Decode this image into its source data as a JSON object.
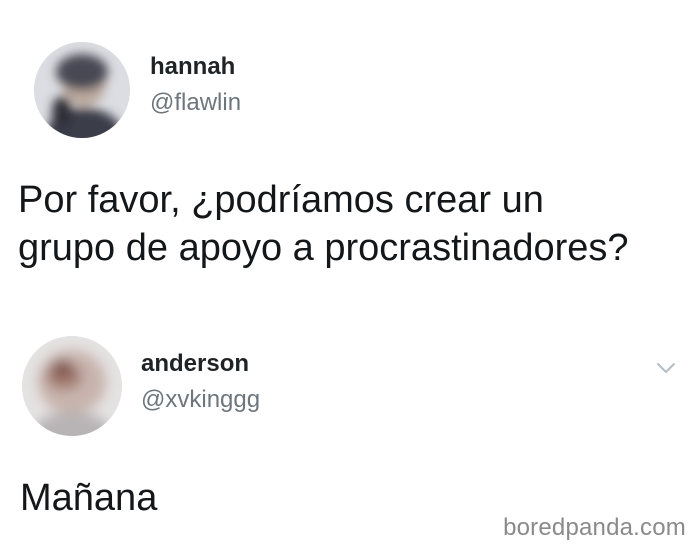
{
  "tweets": [
    {
      "display_name": "hannah",
      "handle": "@flawlin",
      "text_lines": [
        "Por favor, ¿podríamos crear un",
        "grupo de apoyo a procrastinadores?"
      ]
    },
    {
      "display_name": "anderson",
      "handle": "@xvkinggg",
      "text_lines": [
        "Mañana"
      ],
      "menu_icon": "chevron-down-icon"
    }
  ],
  "watermark": "boredpanda.com",
  "colors": {
    "text": "#14171a",
    "handle": "#6e767d",
    "watermark": "#8a8a8a",
    "chevron": "#b5bcc2"
  }
}
